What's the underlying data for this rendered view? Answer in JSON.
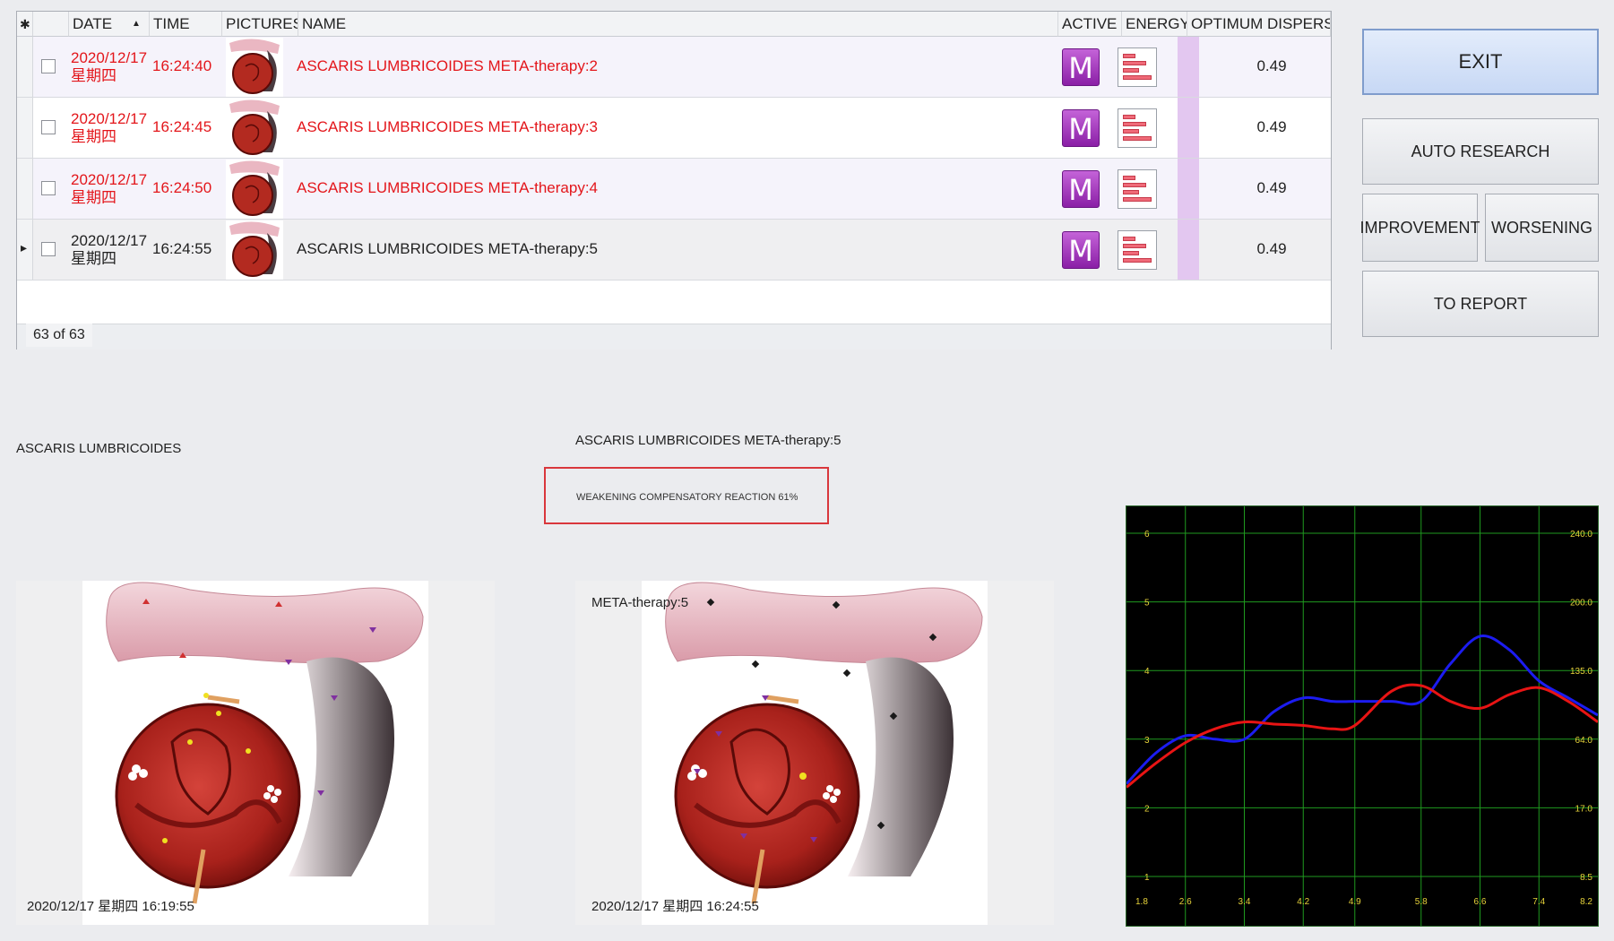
{
  "grid": {
    "headers": {
      "star": "✱",
      "date": "DATE",
      "time": "TIME",
      "pictures": "PICTURES",
      "name": "NAME",
      "active": "ACTIVE",
      "energy": "ENERGY",
      "optimum": "OPTIMUM DISPERSIC"
    },
    "sort_indicator": "▲",
    "rows": [
      {
        "date": "2020/12/17",
        "weekday": "星期四",
        "time": "16:24:40",
        "name": "ASCARIS  LUMBRICOIDES META-therapy:2",
        "active": "M",
        "value": "0.49",
        "highlight": true
      },
      {
        "date": "2020/12/17",
        "weekday": "星期四",
        "time": "16:24:45",
        "name": "ASCARIS  LUMBRICOIDES META-therapy:3",
        "active": "M",
        "value": "0.49",
        "highlight": true
      },
      {
        "date": "2020/12/17",
        "weekday": "星期四",
        "time": "16:24:50",
        "name": "ASCARIS  LUMBRICOIDES META-therapy:4",
        "active": "M",
        "value": "0.49",
        "highlight": true
      },
      {
        "date": "2020/12/17",
        "weekday": "星期四",
        "time": "16:24:55",
        "name": "ASCARIS  LUMBRICOIDES META-therapy:5",
        "active": "M",
        "value": "0.49",
        "highlight": false
      }
    ],
    "current_row_marker": "▸",
    "record_count": "63 of 63"
  },
  "buttons": {
    "exit": "EXIT",
    "auto_research": "AUTO RESEARCH",
    "improvement": "IMPROVEMENT",
    "worsening": "WORSENING",
    "to_report": "TO REPORT"
  },
  "lower": {
    "left_title": "ASCARIS  LUMBRICOIDES",
    "center_title": "ASCARIS  LUMBRICOIDES META-therapy:5",
    "result_text": "WEAKENING COMPENSATORY REACTION 61%",
    "left_stamp": "2020/12/17 星期四 16:19:55",
    "right_caption": "META-therapy:5",
    "right_stamp": "2020/12/17 星期四 16:24:55"
  },
  "colors": {
    "highlight_text": "#e3161b",
    "chart_bg": "#000000",
    "grid_line": "#1f9a1f",
    "axis_text": "#e6d23a",
    "series_blue": "#1c1cf0",
    "series_red": "#e81414"
  },
  "chart_data": {
    "type": "line",
    "x_ticks": [
      "1.8",
      "2.6",
      "3.4",
      "4.2",
      "4.9",
      "5.8",
      "6.6",
      "7.4",
      "8.2"
    ],
    "y_left_ticks": [
      "1",
      "2",
      "3",
      "4",
      "5",
      "6"
    ],
    "y_right_ticks": [
      "8.5",
      "17.0",
      "64.0",
      "135.0",
      "200.0",
      "240.0"
    ],
    "xlim": [
      1.8,
      8.2
    ],
    "ylim": [
      1,
      6
    ],
    "grid": true,
    "series": [
      {
        "color": "blue",
        "x": [
          1.8,
          2.2,
          2.6,
          3.0,
          3.4,
          3.8,
          4.2,
          4.6,
          4.9,
          5.4,
          5.8,
          6.2,
          6.6,
          7.0,
          7.4,
          7.8,
          8.2
        ],
        "y": [
          2.35,
          2.8,
          3.05,
          3.0,
          3.0,
          3.4,
          3.6,
          3.55,
          3.55,
          3.55,
          3.55,
          4.1,
          4.5,
          4.3,
          3.85,
          3.6,
          3.35
        ]
      },
      {
        "color": "red",
        "x": [
          1.8,
          2.2,
          2.6,
          3.0,
          3.4,
          3.8,
          4.2,
          4.6,
          4.9,
          5.4,
          5.8,
          6.2,
          6.6,
          7.0,
          7.4,
          7.8,
          8.2
        ],
        "y": [
          2.3,
          2.65,
          2.95,
          3.15,
          3.25,
          3.22,
          3.2,
          3.15,
          3.2,
          3.7,
          3.78,
          3.55,
          3.45,
          3.65,
          3.75,
          3.55,
          3.25
        ]
      }
    ]
  }
}
